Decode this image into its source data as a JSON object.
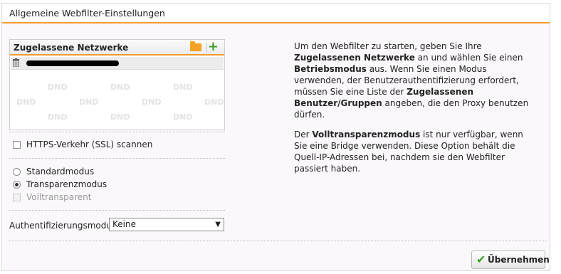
{
  "panel": {
    "title": "Allgemeine Webfilter-Einstellungen"
  },
  "networks": {
    "title": "Zugelassene Netzwerke",
    "placeholder_text": "DND"
  },
  "https_scan": {
    "label": "HTTPS-Verkehr (SSL) scannen",
    "checked": false
  },
  "modes": {
    "standard": "Standardmodus",
    "transparent": "Transparenzmodus",
    "fully_transparent": "Volltransparent",
    "selected": "Transparenzmodus"
  },
  "auth": {
    "label": "Authentifizierungsmodus:",
    "value": "Keine"
  },
  "description": {
    "p1_a": "Um den Webfilter zu starten, geben Sie Ihre ",
    "p1_b": "Zugelassenen Netzwerke",
    "p1_c": " an und wählen Sie einen ",
    "p1_d": "Betriebsmodus",
    "p1_e": " aus. Wenn Sie einen Modus verwenden, der Benutzerauthentifizierung erfordert, müssen Sie eine Liste der ",
    "p1_f": "Zugelassenen Benutzer/Gruppen",
    "p1_g": " angeben, die den Proxy benutzen dürfen.",
    "p2_a": "Der ",
    "p2_b": "Volltransparenzmodus",
    "p2_c": " ist nur verfügbar, wenn Sie eine Bridge verwenden. Diese Option behält die Quell-IP-Adressen bei, nachdem sie den Webfilter passiert haben."
  },
  "buttons": {
    "apply": "Übernehmen"
  },
  "colors": {
    "accent": "#f59a2d",
    "green": "#3a9d23"
  }
}
